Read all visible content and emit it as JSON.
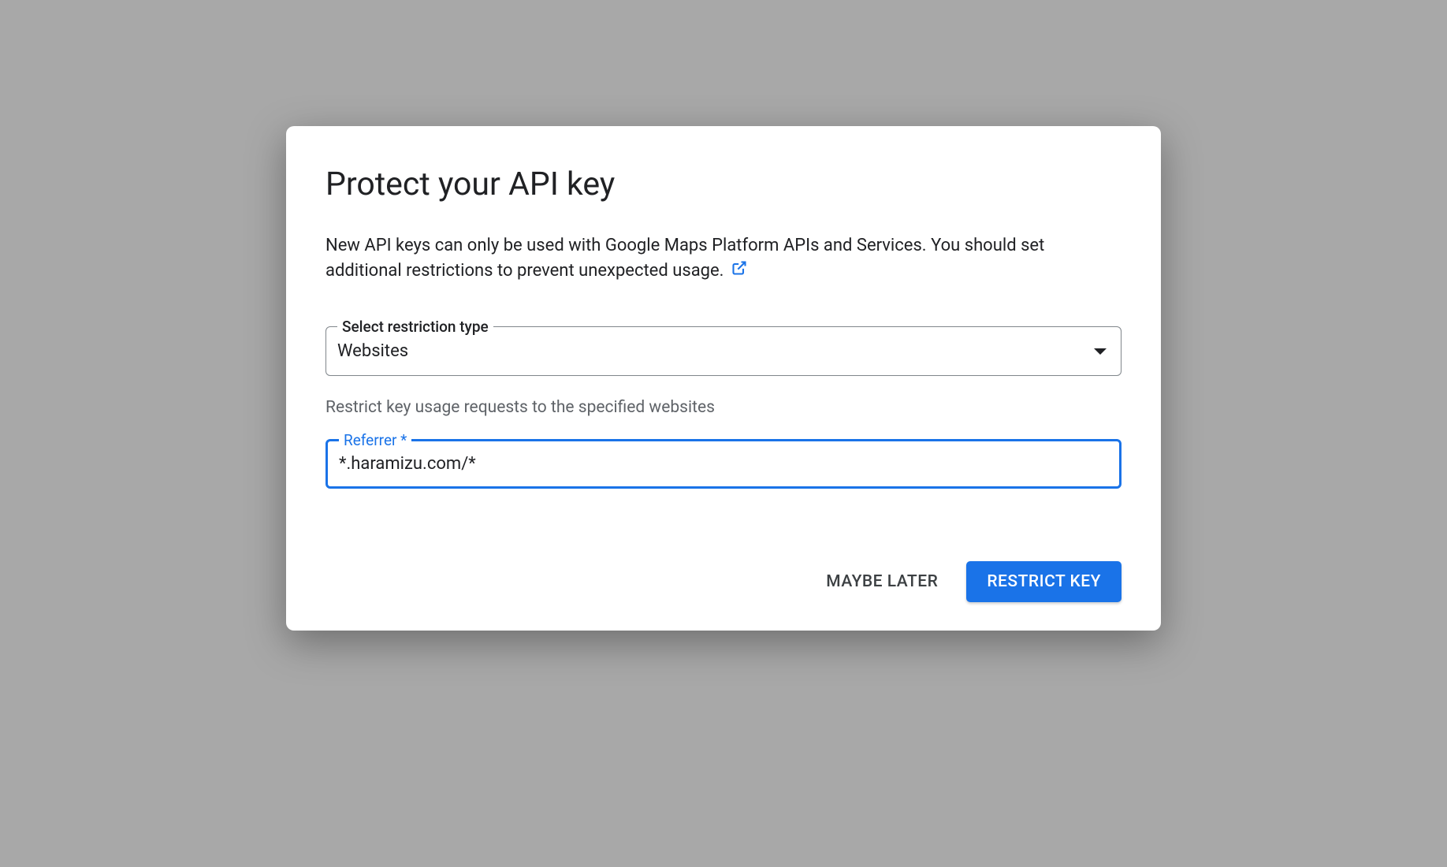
{
  "dialog": {
    "title": "Protect your API key",
    "description": "New API keys can only be used with Google Maps Platform APIs and Services. You should set additional restrictions to prevent unexpected usage.",
    "restrictionType": {
      "label": "Select restriction type",
      "value": "Websites"
    },
    "helperText": "Restrict key usage requests to the specified websites",
    "referrer": {
      "label": "Referrer *",
      "value": "*.haramizu.com/*"
    },
    "actions": {
      "maybeLater": "MAYBE LATER",
      "restrictKey": "RESTRICT KEY"
    }
  }
}
